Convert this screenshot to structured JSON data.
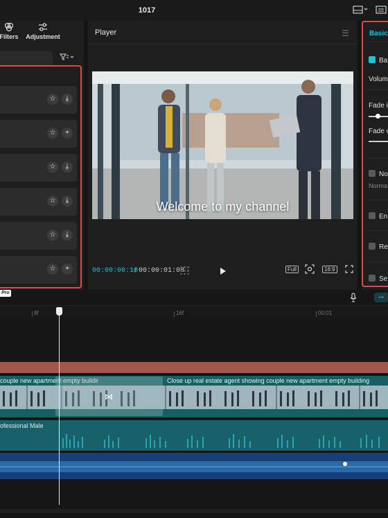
{
  "window": {
    "title": "1017"
  },
  "left_panel": {
    "tabs": [
      {
        "label": "Filters",
        "icon": "filters-icon"
      },
      {
        "label": "Adjustment",
        "icon": "adjustment-icon"
      }
    ],
    "sort_icon": "sort-icon",
    "items": [
      {
        "star_icon": "star-icon",
        "action_icon": "download-icon"
      },
      {
        "star_icon": "star-icon",
        "action_icon": "add-icon"
      },
      {
        "star_icon": "star-icon",
        "action_icon": "download-icon"
      },
      {
        "star_icon": "star-icon",
        "action_icon": "download-icon"
      },
      {
        "star_icon": "star-icon",
        "action_icon": "download-icon"
      },
      {
        "star_icon": "star-icon",
        "action_icon": "add-icon"
      }
    ]
  },
  "player": {
    "title": "Player",
    "caption": "Welcome to my channel",
    "current_time": "00:00:00:10",
    "separator": "/",
    "duration": "00:00:01:08",
    "full_label": "Full",
    "ratio_label": "16:9"
  },
  "right_panel": {
    "tab": "Basic",
    "rows": [
      {
        "label": "Ba",
        "checked": true
      },
      {
        "label": "Volum"
      },
      {
        "label": "Fade i"
      },
      {
        "label": "Fade o"
      },
      {
        "label": "No",
        "checked": false,
        "sub": "Norma"
      },
      {
        "label": "En",
        "checked": false
      },
      {
        "label": "Re",
        "checked": false
      },
      {
        "label": "Se",
        "checked": false
      }
    ]
  },
  "timeline": {
    "pro_badge": "Pro",
    "ticks": [
      "8f",
      "16f",
      "00:01"
    ],
    "video_clip_1": "couple new apartment empty buildir",
    "video_clip_2": "Close up real estate agent showing couple new apartment empty building",
    "audio_clip": "ofessional Male"
  },
  "colors": {
    "accent": "#19c3d8",
    "highlight_border": "#e0484a",
    "text_track": "#a3564b",
    "video_track": "#165f63",
    "audio_track": "#16616a",
    "music_track": "#17407a"
  }
}
